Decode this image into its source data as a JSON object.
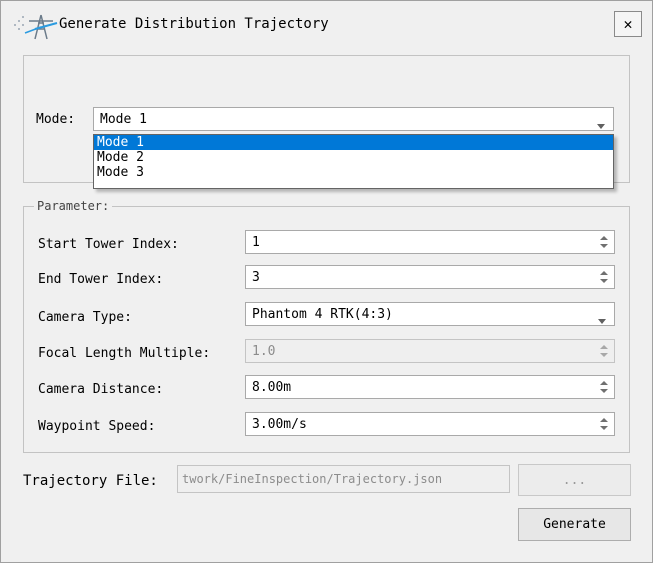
{
  "window": {
    "title": "Generate Distribution Trajectory",
    "close": "✕"
  },
  "mode": {
    "label": "Mode:",
    "value": "Mode 1",
    "options": [
      "Mode 1",
      "Mode 2",
      "Mode 3"
    ],
    "selected_index": 0
  },
  "parameter": {
    "legend": "Parameter:",
    "start_tower_index": {
      "label": "Start Tower Index:",
      "value": "1"
    },
    "end_tower_index": {
      "label": "End Tower Index:",
      "value": "3"
    },
    "camera_type": {
      "label": "Camera Type:",
      "value": "Phantom 4 RTK(4:3)"
    },
    "focal_length_multiple": {
      "label": "Focal Length Multiple:",
      "value": "1.0"
    },
    "camera_distance": {
      "label": "Camera Distance:",
      "value": "8.00m"
    },
    "waypoint_speed": {
      "label": "Waypoint Speed:",
      "value": "3.00m/s"
    }
  },
  "trajectory_file": {
    "label": "Trajectory File:",
    "value": "twork/FineInspection/Trajectory.json",
    "browse_label": "..."
  },
  "generate_label": "Generate",
  "colors": {
    "selection": "#0078d7",
    "dialog_bg": "#f0f0f0"
  }
}
